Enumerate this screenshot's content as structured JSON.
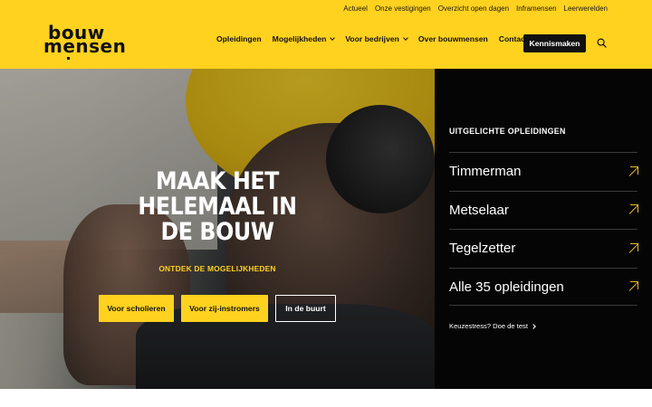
{
  "topbar": {
    "links": [
      "Actueel",
      "Onze vestigingen",
      "Overzicht open dagen",
      "Inframensen",
      "Leerwerelden"
    ]
  },
  "logo": {
    "line1": "bouw",
    "line2": "mensen"
  },
  "mainnav": {
    "items": [
      {
        "label": "Opleidingen",
        "dropdown": false
      },
      {
        "label": "Mogelijkheden",
        "dropdown": true
      },
      {
        "label": "Voor bedrijven",
        "dropdown": true
      },
      {
        "label": "Over bouwmensen",
        "dropdown": false
      },
      {
        "label": "Contact",
        "dropdown": false
      }
    ],
    "cta_label": "Kennismaken",
    "search_icon": "search-icon"
  },
  "hero": {
    "headline": "MAAK HET HELEMAAL IN DE BOUW",
    "subline": "ONTDEK DE MOGELIJKHEDEN",
    "buttons": [
      "Voor scholieren",
      "Voor zij-instromers",
      "In de buurt"
    ]
  },
  "panel": {
    "title": "UITGELICHTE OPLEIDINGEN",
    "items": [
      "Timmerman",
      "Metselaar",
      "Tegelzetter",
      "Alle 35 opleidingen"
    ],
    "test_link": "Keuzestress? Doe de test"
  },
  "colors": {
    "brand_yellow": "#ffd21f",
    "dark": "#050505",
    "arrow": "#e6b82f"
  }
}
